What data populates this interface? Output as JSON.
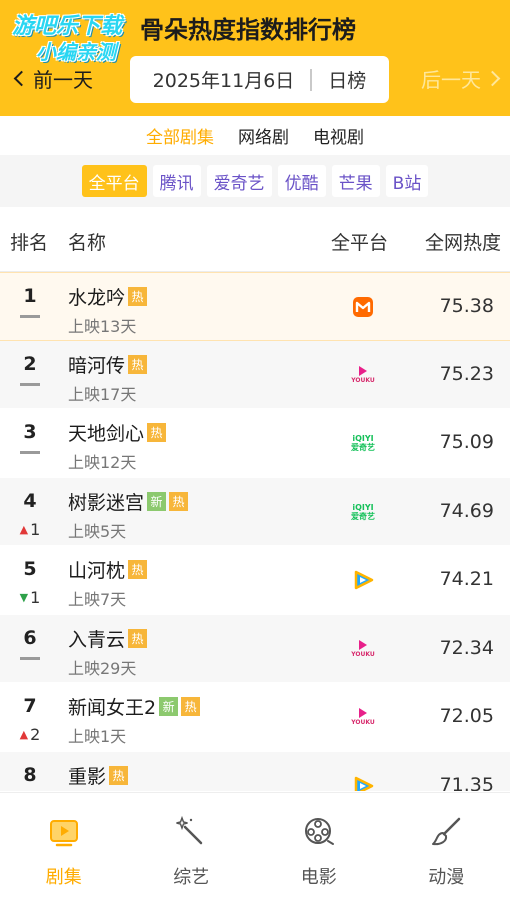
{
  "header": {
    "watermark_line1": "游吧乐下载",
    "watermark_line2": "小编亲测",
    "title": "骨朵热度指数排行榜",
    "prev_label": "前一天",
    "next_label": "后一天",
    "date": "2025年11月6日",
    "period": "日榜"
  },
  "categories": [
    {
      "label": "全部剧集",
      "active": true
    },
    {
      "label": "网络剧",
      "active": false
    },
    {
      "label": "电视剧",
      "active": false
    }
  ],
  "platforms": [
    {
      "label": "全平台",
      "active": true
    },
    {
      "label": "腾讯",
      "active": false
    },
    {
      "label": "爱奇艺",
      "active": false
    },
    {
      "label": "优酷",
      "active": false
    },
    {
      "label": "芒果",
      "active": false
    },
    {
      "label": "B站",
      "active": false
    }
  ],
  "table": {
    "headers": {
      "rank": "排名",
      "name": "名称",
      "platform": "全平台",
      "heat": "全网热度"
    },
    "rows": [
      {
        "rank": "1",
        "name": "水龙吟",
        "tags": [
          "热"
        ],
        "days": "上映13天",
        "trend": "same",
        "trend_value": "",
        "platform": "mango-icon",
        "heat": "75.38"
      },
      {
        "rank": "2",
        "name": "暗河传",
        "tags": [
          "热"
        ],
        "days": "上映17天",
        "trend": "same",
        "trend_value": "",
        "platform": "youku-icon",
        "heat": "75.23"
      },
      {
        "rank": "3",
        "name": "天地剑心",
        "tags": [
          "热"
        ],
        "days": "上映12天",
        "trend": "same",
        "trend_value": "",
        "platform": "iqiyi-icon",
        "heat": "75.09"
      },
      {
        "rank": "4",
        "name": "树影迷宫",
        "tags": [
          "新",
          "热"
        ],
        "days": "上映5天",
        "trend": "up",
        "trend_value": "1",
        "platform": "iqiyi-icon",
        "heat": "74.69"
      },
      {
        "rank": "5",
        "name": "山河枕",
        "tags": [
          "热"
        ],
        "days": "上映7天",
        "trend": "down",
        "trend_value": "1",
        "platform": "tencent-icon",
        "heat": "74.21"
      },
      {
        "rank": "6",
        "name": "入青云",
        "tags": [
          "热"
        ],
        "days": "上映29天",
        "trend": "same",
        "trend_value": "",
        "platform": "youku-icon",
        "heat": "72.34"
      },
      {
        "rank": "7",
        "name": "新闻女王2",
        "tags": [
          "新",
          "热"
        ],
        "days": "上映1天",
        "trend": "up",
        "trend_value": "2",
        "platform": "youku-icon",
        "heat": "72.05"
      },
      {
        "rank": "8",
        "name": "重影",
        "tags": [
          "热"
        ],
        "days": "",
        "trend": "same",
        "trend_value": "",
        "platform": "tencent-icon",
        "heat": "71.35"
      }
    ]
  },
  "platform_logos": {
    "youku_text": "YOUKU",
    "iqiyi_text1": "iQIYI",
    "iqiyi_text2": "爱奇艺"
  },
  "bottom_nav": [
    {
      "label": "剧集",
      "icon": "tv-icon",
      "active": true
    },
    {
      "label": "综艺",
      "icon": "magic-wand-icon",
      "active": false
    },
    {
      "label": "电影",
      "icon": "film-reel-icon",
      "active": false
    },
    {
      "label": "动漫",
      "icon": "brush-icon",
      "active": false
    }
  ],
  "colors": {
    "accent": "#ffc21a",
    "active_text": "#ffac00",
    "chip_text": "#6a52c7",
    "up": "#e13838",
    "down": "#2ea14a"
  }
}
